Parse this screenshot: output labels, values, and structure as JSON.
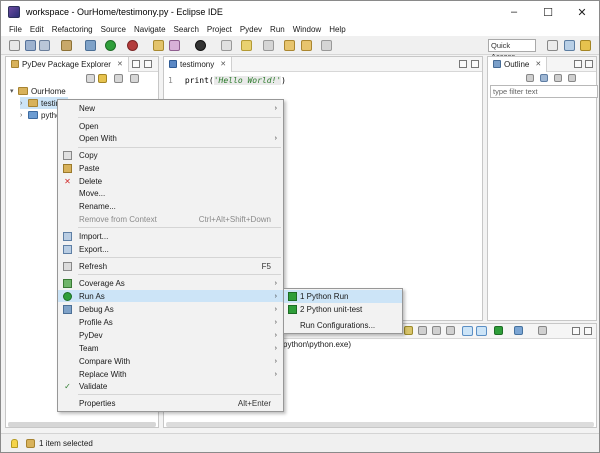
{
  "window": {
    "title": "workspace - OurHome/testimony.py - Eclipse IDE",
    "minimize": "–",
    "maximize": "☐",
    "close": "✕"
  },
  "menubar": [
    "File",
    "Edit",
    "Refactoring",
    "Source",
    "Navigate",
    "Search",
    "Project",
    "Pydev",
    "Run",
    "Window",
    "Help"
  ],
  "toolbar": {
    "quick_access": "Quick Access"
  },
  "explorer": {
    "tab_label": "PyDev Package Explorer",
    "project": "OurHome",
    "items": [
      "testim",
      "pytho"
    ]
  },
  "editor": {
    "tab_label": "testimony",
    "line_number": "1",
    "code_fn": "print(",
    "code_str": "'Hello World!'",
    "code_end": ")"
  },
  "outline": {
    "tab_label": "Outline",
    "filter_placeholder": "type filter text"
  },
  "console": {
    "text": "python\\python.exe)"
  },
  "context_menu": {
    "items": [
      {
        "label": "New",
        "submenu": true
      },
      {
        "label": "Open"
      },
      {
        "label": "Open With",
        "submenu": true
      },
      {
        "label": "Copy",
        "icon": "copy-icon"
      },
      {
        "label": "Paste",
        "icon": "paste-icon"
      },
      {
        "label": "Delete",
        "icon": "delete-icon"
      },
      {
        "label": "Move..."
      },
      {
        "label": "Rename..."
      },
      {
        "label": "Remove from Context",
        "shortcut": "Ctrl+Alt+Shift+Down",
        "disabled": true
      },
      {
        "label": "Import...",
        "icon": "import-icon"
      },
      {
        "label": "Export...",
        "icon": "export-icon"
      },
      {
        "label": "Refresh",
        "shortcut": "F5",
        "icon": "refresh-icon"
      },
      {
        "label": "Coverage As",
        "submenu": true,
        "icon": "coverage-icon"
      },
      {
        "label": "Run As",
        "submenu": true,
        "icon": "run-icon",
        "highlighted": true
      },
      {
        "label": "Debug As",
        "submenu": true,
        "icon": "debug-icon"
      },
      {
        "label": "Profile As",
        "submenu": true
      },
      {
        "label": "PyDev",
        "submenu": true
      },
      {
        "label": "Team",
        "submenu": true
      },
      {
        "label": "Compare With",
        "submenu": true
      },
      {
        "label": "Replace With",
        "submenu": true
      },
      {
        "label": "Validate",
        "icon": "check-icon"
      },
      {
        "label": "Properties",
        "shortcut": "Alt+Enter"
      }
    ]
  },
  "run_as_submenu": {
    "items": [
      {
        "label": "1 Python Run",
        "highlighted": true
      },
      {
        "label": "2 Python unit-test"
      },
      {
        "label": "Run Configurations..."
      }
    ]
  },
  "status": {
    "text": "1 item selected"
  },
  "colors": {
    "highlight": "#cce4f7",
    "menu_bg": "#f2f2f2",
    "string_green": "#2a7a2a"
  }
}
